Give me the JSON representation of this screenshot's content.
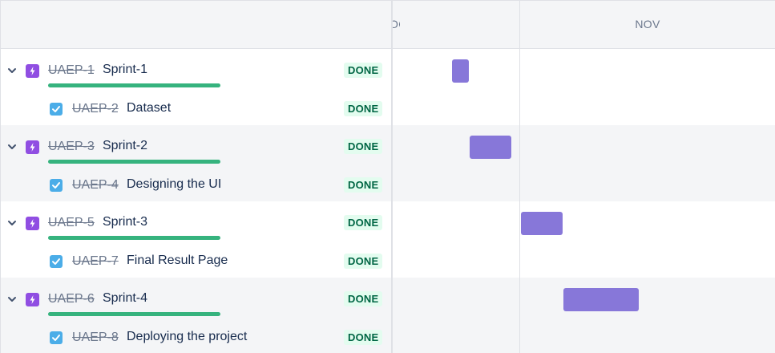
{
  "timeline": {
    "months": [
      "OCT",
      "NOV"
    ]
  },
  "issues": [
    {
      "type": "epic",
      "key": "UAEP-1",
      "summary": "Sprint-1",
      "status": "DONE"
    },
    {
      "type": "task",
      "key": "UAEP-2",
      "summary": "Dataset",
      "status": "DONE"
    },
    {
      "type": "epic",
      "key": "UAEP-3",
      "summary": "Sprint-2",
      "status": "DONE"
    },
    {
      "type": "task",
      "key": "UAEP-4",
      "summary": "Designing the UI",
      "status": "DONE"
    },
    {
      "type": "epic",
      "key": "UAEP-5",
      "summary": "Sprint-3",
      "status": "DONE"
    },
    {
      "type": "task",
      "key": "UAEP-7",
      "summary": "Final Result Page",
      "status": "DONE"
    },
    {
      "type": "epic",
      "key": "UAEP-6",
      "summary": "Sprint-4",
      "status": "DONE"
    },
    {
      "type": "task",
      "key": "UAEP-8",
      "summary": "Deploying the project",
      "status": "DONE"
    }
  ],
  "epic_progress": [
    1,
    1,
    1,
    1
  ],
  "colors": {
    "epic_icon": "#904ee2",
    "task_icon": "#4bade8",
    "progress": "#36b37e",
    "timeline_bar": "#8777d9",
    "done_lozenge_bg": "#e3fcef",
    "done_lozenge_text": "#006644"
  },
  "icons": {
    "expand": "chevron-down-icon",
    "epic": "epic-lightning-icon",
    "task": "task-checkbox-icon"
  }
}
